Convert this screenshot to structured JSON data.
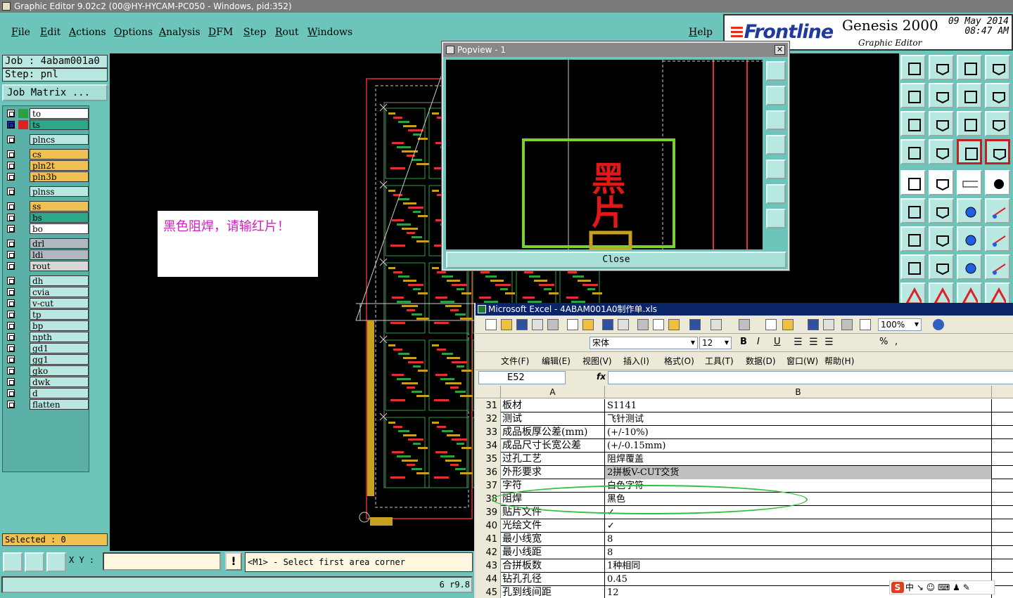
{
  "window": {
    "title": "Graphic Editor 9.02c2 (00@HY-HYCAM-PC050 - Windows, pid:352)"
  },
  "menu": [
    "File",
    "Edit",
    "Actions",
    "Options",
    "Analysis",
    "DFM",
    "Step",
    "Rout",
    "Windows"
  ],
  "help": "Help",
  "brand": {
    "logo": "Frontline",
    "product": "Genesis 2000",
    "subtitle": "Graphic Editor",
    "date": "09 May 2014",
    "time": "08:47 AM"
  },
  "job": {
    "job": "Job : 4abam001a0",
    "step": "Step: pnl",
    "matrix_button": "Job Matrix ..."
  },
  "layers": [
    {
      "name": "to",
      "bg": "#ffffff",
      "sw": "#2aa040"
    },
    {
      "name": "ts",
      "bg": "#2ea88a",
      "sw": "#e02020",
      "active": true
    },
    {
      "name": "plncs",
      "bg": "#b8e8e0",
      "sw": ""
    },
    {
      "name": "cs",
      "bg": "#f0c050",
      "sw": ""
    },
    {
      "name": "pln2t",
      "bg": "#f0c050",
      "sw": ""
    },
    {
      "name": "pln3b",
      "bg": "#f0c050",
      "sw": ""
    },
    {
      "name": "plnss",
      "bg": "#b8e8e0",
      "sw": ""
    },
    {
      "name": "ss",
      "bg": "#f0c050",
      "sw": ""
    },
    {
      "name": "bs",
      "bg": "#2ea88a",
      "sw": ""
    },
    {
      "name": "bo",
      "bg": "#ffffff",
      "sw": ""
    },
    {
      "name": "drl",
      "bg": "#b0b8c0",
      "sw": ""
    },
    {
      "name": "ldi",
      "bg": "#b0b8c0",
      "sw": ""
    },
    {
      "name": "rout",
      "bg": "#d8d8d8",
      "sw": ""
    },
    {
      "name": "dh",
      "bg": "#b8e8e0",
      "sw": ""
    },
    {
      "name": "cvia",
      "bg": "#b8e8e0",
      "sw": ""
    },
    {
      "name": "v-cut",
      "bg": "#b8e8e0",
      "sw": ""
    },
    {
      "name": "tp",
      "bg": "#b8e8e0",
      "sw": ""
    },
    {
      "name": "bp",
      "bg": "#b8e8e0",
      "sw": ""
    },
    {
      "name": "npth",
      "bg": "#b8e8e0",
      "sw": ""
    },
    {
      "name": "gd1",
      "bg": "#b8e8e0",
      "sw": ""
    },
    {
      "name": "gg1",
      "bg": "#b8e8e0",
      "sw": ""
    },
    {
      "name": "gko",
      "bg": "#b8e8e0",
      "sw": ""
    },
    {
      "name": "dwk",
      "bg": "#b8e8e0",
      "sw": ""
    },
    {
      "name": "d",
      "bg": "#b8e8e0",
      "sw": ""
    },
    {
      "name": "flatten",
      "bg": "#b8e8e0",
      "sw": ""
    }
  ],
  "selected": "Selected : 0",
  "note": "黑色阻焊，请输红片！",
  "popview": {
    "title": "Popview - 1",
    "close": "Close",
    "text": "黑片"
  },
  "bottom": {
    "xy_label": "X Y :",
    "xy_value": "",
    "excl": "!",
    "message": "<M1> - Select first area corner",
    "status": "6 r9.8"
  },
  "excel": {
    "title": "Microsoft Excel - 4ABAM001A0制作单.xls",
    "zoom": "100%",
    "font": "宋体",
    "size": "12",
    "menus": [
      "文件(F)",
      "编辑(E)",
      "视图(V)",
      "插入(I)",
      "格式(O)",
      "工具(T)",
      "数据(D)",
      "窗口(W)",
      "帮助(H)"
    ],
    "cell_ref": "E52",
    "fx": "fx",
    "col_a": "A",
    "col_b": "B",
    "rows": [
      {
        "n": "31",
        "a": "板材",
        "b": "S1141"
      },
      {
        "n": "32",
        "a": "测试",
        "b": "飞针测试"
      },
      {
        "n": "33",
        "a": "成品板厚公差(mm)",
        "b": "(+/-10%)"
      },
      {
        "n": "34",
        "a": "成品尺寸长宽公差",
        "b": "(+/-0.15mm)"
      },
      {
        "n": "35",
        "a": "过孔工艺",
        "b": "阻焊覆盖"
      },
      {
        "n": "36",
        "a": "外形要求",
        "b": "2拼板V-CUT交货",
        "hl": true
      },
      {
        "n": "37",
        "a": "字符",
        "b": "白色字符"
      },
      {
        "n": "38",
        "a": "阻焊",
        "b": "黑色"
      },
      {
        "n": "39",
        "a": "贴片文件",
        "b": "✓"
      },
      {
        "n": "40",
        "a": "光绘文件",
        "b": "✓"
      },
      {
        "n": "41",
        "a": "最小线宽",
        "b": "8"
      },
      {
        "n": "42",
        "a": "最小线距",
        "b": "8"
      },
      {
        "n": "43",
        "a": "合拼板数",
        "b": "1种相同"
      },
      {
        "n": "44",
        "a": "钻孔孔径",
        "b": "0.45"
      },
      {
        "n": "45",
        "a": "孔到线间距",
        "b": "12"
      }
    ]
  },
  "ime": {
    "logo": "S",
    "text": "中 ↘ ☺ ⌨ ♟ ✎"
  }
}
